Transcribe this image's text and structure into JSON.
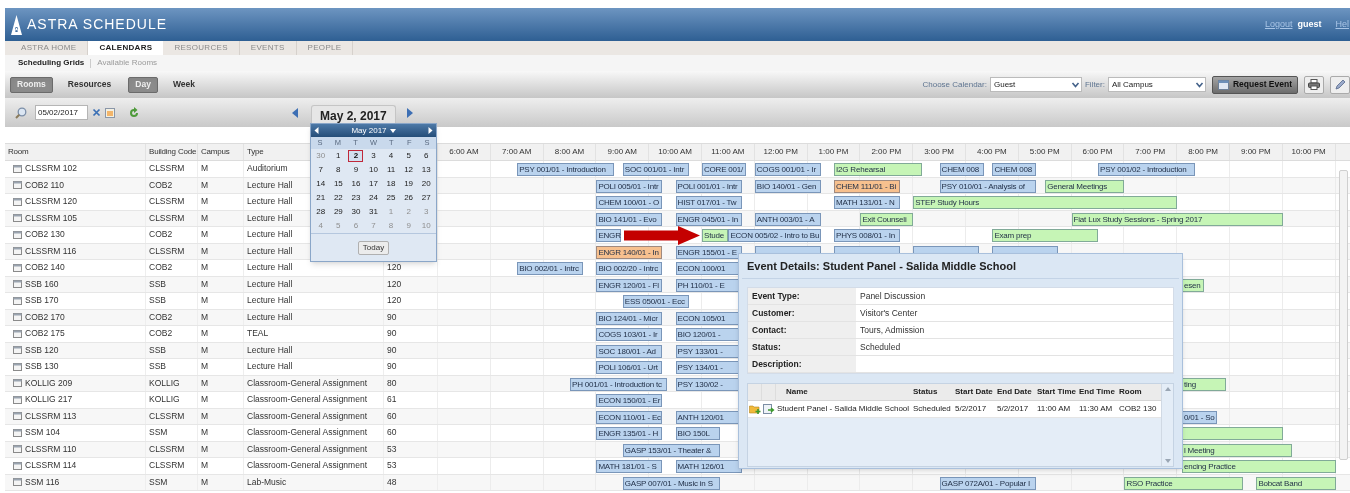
{
  "header": {
    "app_title": "ASTRA SCHEDULE",
    "logout": "Logout",
    "user": "guest",
    "help": "Hel"
  },
  "tabs": [
    {
      "label": "ASTRA HOME",
      "selected": false
    },
    {
      "label": "CALENDARS",
      "selected": true
    },
    {
      "label": "RESOURCES",
      "selected": false
    },
    {
      "label": "EVENTS",
      "selected": false
    },
    {
      "label": "PEOPLE",
      "selected": false
    }
  ],
  "subtabs": [
    {
      "label": "Scheduling Grids",
      "selected": true
    },
    {
      "label": "Available Rooms",
      "selected": false
    }
  ],
  "view_toggles": [
    {
      "label": "Rooms",
      "selected": true
    },
    {
      "label": "Resources",
      "selected": false
    }
  ],
  "range_toggles": [
    {
      "label": "Day",
      "selected": true
    },
    {
      "label": "Week",
      "selected": false
    }
  ],
  "calendar_select": {
    "label": "Choose Calendar:",
    "value": "Guest"
  },
  "filter_select": {
    "label": "Filter:",
    "value": "All Campus"
  },
  "request_button": "Request Event",
  "date_field": {
    "value": "05/02/2017"
  },
  "date_heading": "May 2, 2017",
  "date_picker": {
    "month": "May 2017",
    "weekdays": [
      "S",
      "M",
      "T",
      "W",
      "T",
      "F",
      "S"
    ],
    "today_button": "Today",
    "days": [
      {
        "day": "30",
        "muted": true,
        "selected": false
      },
      {
        "day": "1",
        "muted": false,
        "selected": false
      },
      {
        "day": "2",
        "muted": false,
        "selected": true
      },
      {
        "day": "3",
        "muted": false,
        "selected": false
      },
      {
        "day": "4",
        "muted": false,
        "selected": false
      },
      {
        "day": "5",
        "muted": false,
        "selected": false
      },
      {
        "day": "6",
        "muted": false,
        "selected": false
      },
      {
        "day": "7",
        "muted": false,
        "selected": false
      },
      {
        "day": "8",
        "muted": false,
        "selected": false
      },
      {
        "day": "9",
        "muted": false,
        "selected": false
      },
      {
        "day": "10",
        "muted": false,
        "selected": false
      },
      {
        "day": "11",
        "muted": false,
        "selected": false
      },
      {
        "day": "12",
        "muted": false,
        "selected": false
      },
      {
        "day": "13",
        "muted": false,
        "selected": false
      },
      {
        "day": "14",
        "muted": false,
        "selected": false
      },
      {
        "day": "15",
        "muted": false,
        "selected": false
      },
      {
        "day": "16",
        "muted": false,
        "selected": false
      },
      {
        "day": "17",
        "muted": false,
        "selected": false
      },
      {
        "day": "18",
        "muted": false,
        "selected": false
      },
      {
        "day": "19",
        "muted": false,
        "selected": false
      },
      {
        "day": "20",
        "muted": false,
        "selected": false
      },
      {
        "day": "21",
        "muted": false,
        "selected": false
      },
      {
        "day": "22",
        "muted": false,
        "selected": false
      },
      {
        "day": "23",
        "muted": false,
        "selected": false
      },
      {
        "day": "24",
        "muted": false,
        "selected": false
      },
      {
        "day": "25",
        "muted": false,
        "selected": false
      },
      {
        "day": "26",
        "muted": false,
        "selected": false
      },
      {
        "day": "27",
        "muted": false,
        "selected": false
      },
      {
        "day": "28",
        "muted": false,
        "selected": false
      },
      {
        "day": "29",
        "muted": false,
        "selected": false
      },
      {
        "day": "30",
        "muted": false,
        "selected": false
      },
      {
        "day": "31",
        "muted": false,
        "selected": false
      },
      {
        "day": "1",
        "muted": true,
        "selected": false
      },
      {
        "day": "2",
        "muted": true,
        "selected": false
      },
      {
        "day": "3",
        "muted": true,
        "selected": false
      },
      {
        "day": "4",
        "muted": true,
        "selected": false
      },
      {
        "day": "5",
        "muted": true,
        "selected": false
      },
      {
        "day": "6",
        "muted": true,
        "selected": false
      },
      {
        "day": "7",
        "muted": true,
        "selected": false
      },
      {
        "day": "8",
        "muted": true,
        "selected": false
      },
      {
        "day": "9",
        "muted": true,
        "selected": false
      },
      {
        "day": "10",
        "muted": true,
        "selected": false
      }
    ]
  },
  "grid": {
    "columns": [
      "Room",
      "Building Code",
      "Campus",
      "Type"
    ],
    "hours": [
      "6:00 AM",
      "7:00 AM",
      "8:00 AM",
      "9:00 AM",
      "10:00 AM",
      "11:00 AM",
      "12:00 PM",
      "1:00 PM",
      "2:00 PM",
      "3:00 PM",
      "4:00 PM",
      "5:00 PM",
      "6:00 PM",
      "7:00 PM",
      "8:00 PM",
      "9:00 PM",
      "10:00 PM"
    ],
    "rows": [
      {
        "room": "CLSSRM 102",
        "building_code": "CLSSRM",
        "campus": "M",
        "type": "Auditorium",
        "events": [
          {
            "title": "PSY 001/01 - Introduction",
            "color": "#bad3ee"
          },
          {
            "title": "SOC 001/01 - Intr",
            "color": "#bad3ee"
          },
          {
            "title": "CORE 001/",
            "color": "#bad3ee"
          },
          {
            "title": "COGS 001/01 - Ir",
            "color": "#bad3ee"
          },
          {
            "title": "I2G Rehearsal",
            "color": "#c6f5b6"
          },
          {
            "title": "CHEM 008",
            "color": "#bad3ee"
          },
          {
            "title": "CHEM 008",
            "color": "#bad3ee"
          },
          {
            "title": "PSY 001/02 - Introduction",
            "color": "#bad3ee"
          }
        ]
      },
      {
        "room": "COB2 110",
        "building_code": "COB2",
        "campus": "M",
        "type": "Lecture Hall",
        "events": [
          {
            "title": "POLI 005/01 - Intr",
            "color": "#bad3ee"
          },
          {
            "title": "POLI 001/01 - Intr",
            "color": "#bad3ee"
          },
          {
            "title": "BIO 140/01 - Gen",
            "color": "#bad3ee"
          },
          {
            "title": "CHEM 111/01 - Bi",
            "color": "#f7c08e"
          },
          {
            "title": "PSY 010/01 - Analysis of",
            "color": "#bad3ee"
          },
          {
            "title": "General Meetings",
            "color": "#c6f5b6"
          }
        ]
      },
      {
        "room": "CLSSRM 120",
        "building_code": "CLSSRM",
        "campus": "M",
        "type": "Lecture Hall",
        "events": [
          {
            "title": "CHEM 100/01 - O",
            "color": "#bad3ee"
          },
          {
            "title": "HIST 017/01 - Tw",
            "color": "#bad3ee"
          },
          {
            "title": "MATH 131/01 - N",
            "color": "#bad3ee"
          },
          {
            "title": "STEP Study Hours",
            "color": "#c6f5b6"
          }
        ]
      },
      {
        "room": "CLSSRM 105",
        "building_code": "CLSSRM",
        "campus": "M",
        "type": "Lecture Hall",
        "events": [
          {
            "title": "BIO 141/01 - Evo",
            "color": "#bad3ee"
          },
          {
            "title": "ENGR 045/01 - In",
            "color": "#bad3ee"
          },
          {
            "title": "ANTH 003/01 - A",
            "color": "#bad3ee"
          },
          {
            "title": "Exit Counseli",
            "color": "#c6f5b6"
          },
          {
            "title": "Fiat Lux Study Sessions - Spring 2017",
            "color": "#c6f5b6"
          }
        ]
      },
      {
        "room": "COB2 130",
        "building_code": "COB2",
        "campus": "M",
        "type": "Lecture Hall",
        "events": [
          {
            "title": "ENGR",
            "color": "#bad3ee"
          },
          {
            "title": "Stude",
            "color": "#c6f5b6"
          },
          {
            "title": "ECON 005/02 - Intro to Bu",
            "color": "#bad3ee"
          },
          {
            "title": "PHYS 008/01 - In",
            "color": "#bad3ee"
          },
          {
            "title": "Exam prep",
            "color": "#c6f5b6"
          }
        ]
      },
      {
        "room": "CLSSRM 116",
        "building_code": "CLSSRM",
        "campus": "M",
        "type": "Lecture Hall",
        "events": [
          {
            "title": "ENGR 140/01 - In",
            "color": "#f7c08e"
          },
          {
            "title": "ENGR 155/01 - E",
            "color": "#bad3ee"
          },
          {
            "color": "#bad3ee"
          },
          {
            "color": "#bad3ee"
          },
          {
            "color": "#bad3ee"
          },
          {
            "color": "#bad3ee"
          }
        ]
      },
      {
        "room": "COB2 140",
        "building_code": "COB2",
        "campus": "M",
        "type": "Lecture Hall",
        "capacity": "120",
        "events": [
          {
            "title": "BIO 002/01 - Intrc",
            "color": "#bad3ee"
          },
          {
            "title": "BIO 002/20 - Intrc",
            "color": "#bad3ee"
          },
          {
            "title": "ECON 100/01",
            "color": "#bad3ee"
          }
        ]
      },
      {
        "room": "SSB 160",
        "building_code": "SSB",
        "campus": "M",
        "type": "Lecture Hall",
        "capacity": "120",
        "events": [
          {
            "title": "ENGR 120/01 - Fl",
            "color": "#bad3ee"
          },
          {
            "title": "PH 110/01 - E",
            "color": "#bad3ee"
          },
          {
            "title": "esen",
            "color": "#c6f5b6"
          }
        ]
      },
      {
        "room": "SSB 170",
        "building_code": "SSB",
        "campus": "M",
        "type": "Lecture Hall",
        "capacity": "120",
        "events": [
          {
            "title": "ESS 050/01 - Ecc",
            "color": "#bad3ee"
          }
        ]
      },
      {
        "room": "COB2 170",
        "building_code": "COB2",
        "campus": "M",
        "type": "Lecture Hall",
        "capacity": "90",
        "events": [
          {
            "title": "BIO 124/01 - Micr",
            "color": "#bad3ee"
          },
          {
            "title": "ECON 105/01",
            "color": "#bad3ee"
          }
        ]
      },
      {
        "room": "COB2 175",
        "building_code": "COB2",
        "campus": "M",
        "type": "TEAL",
        "capacity": "90",
        "events": [
          {
            "title": "COGS 103/01 - Ir",
            "color": "#bad3ee"
          },
          {
            "title": "BIO 120/01 -",
            "color": "#bad3ee"
          }
        ]
      },
      {
        "room": "SSB 120",
        "building_code": "SSB",
        "campus": "M",
        "type": "Lecture Hall",
        "capacity": "90",
        "events": [
          {
            "title": "SOC 180/01 - Ad",
            "color": "#bad3ee"
          },
          {
            "title": "PSY 133/01 -",
            "color": "#bad3ee"
          }
        ]
      },
      {
        "room": "SSB 130",
        "building_code": "SSB",
        "campus": "M",
        "type": "Lecture Hall",
        "capacity": "90",
        "events": [
          {
            "title": "POLI 106/01 - Urt",
            "color": "#bad3ee"
          },
          {
            "title": "PSY 134/01 -",
            "color": "#bad3ee"
          }
        ]
      },
      {
        "room": "KOLLIG 209",
        "building_code": "KOLLIG",
        "campus": "M",
        "type": "Classroom-General Assignment",
        "capacity": "80",
        "events": [
          {
            "title": "PH 001/01 - Introduction tc",
            "color": "#bad3ee"
          },
          {
            "title": "PSY 130/02 -",
            "color": "#bad3ee"
          },
          {
            "title": "ting",
            "color": "#c6f5b6"
          }
        ]
      },
      {
        "room": "KOLLIG 217",
        "building_code": "KOLLIG",
        "campus": "M",
        "type": "Classroom-General Assignment",
        "capacity": "61",
        "events": [
          {
            "title": "ECON 150/01 - Er",
            "color": "#bad3ee"
          }
        ]
      },
      {
        "room": "CLSSRM 113",
        "building_code": "CLSSRM",
        "campus": "M",
        "type": "Classroom-General Assignment",
        "capacity": "60",
        "events": [
          {
            "title": "ECON 110/01 - Ec",
            "color": "#bad3ee"
          },
          {
            "title": "ANTH 120/01",
            "color": "#bad3ee"
          },
          {
            "title": "0/01 - So",
            "color": "#bad3ee"
          }
        ]
      },
      {
        "room": "SSM 104",
        "building_code": "SSM",
        "campus": "M",
        "type": "Classroom-General Assignment",
        "capacity": "60",
        "events": [
          {
            "title": "ENGR 135/01 - H",
            "color": "#bad3ee"
          },
          {
            "title": "BIO 150L",
            "color": "#bad3ee"
          },
          {
            "color": "#c6f5b6"
          }
        ]
      },
      {
        "room": "CLSSRM 110",
        "building_code": "CLSSRM",
        "campus": "M",
        "type": "Classroom-General Assignment",
        "capacity": "53",
        "events": [
          {
            "title": "GASP 153/01 - Theater &",
            "color": "#bad3ee"
          },
          {
            "title": "l Meeting",
            "color": "#c6f5b6"
          }
        ]
      },
      {
        "room": "CLSSRM 114",
        "building_code": "CLSSRM",
        "campus": "M",
        "type": "Classroom-General Assignment",
        "capacity": "53",
        "events": [
          {
            "title": "MATH 181/01 - S",
            "color": "#bad3ee"
          },
          {
            "title": "MATH 126/01",
            "color": "#bad3ee"
          },
          {
            "title": "encing Practice",
            "color": "#c6f5b6"
          }
        ]
      },
      {
        "room": "SSM 116",
        "building_code": "SSM",
        "campus": "M",
        "type": "Lab-Music",
        "capacity": "48",
        "events": [
          {
            "title": "GASP 007/01 - Music in S",
            "color": "#bad3ee"
          },
          {
            "title": "GASP 072A/01 - Popular I",
            "color": "#bad3ee"
          },
          {
            "title": "RSO Practice",
            "color": "#c6f5b6"
          },
          {
            "title": "Bobcat Band",
            "color": "#c6f5b6"
          }
        ]
      }
    ]
  },
  "event_details": {
    "title": "Event Details: Student Panel - Salida Middle School",
    "fields": [
      {
        "label": "Event Type:",
        "value": "Panel Discussion"
      },
      {
        "label": "Customer:",
        "value": "Visitor's Center"
      },
      {
        "label": "Contact:",
        "value": "Tours, Admission"
      },
      {
        "label": "Status:",
        "value": "Scheduled"
      },
      {
        "label": "Description:"
      }
    ],
    "list": {
      "columns": [
        "Name",
        "Status",
        "Start Date",
        "End Date",
        "Start Time",
        "End Time",
        "Room"
      ],
      "rows": [
        {
          "cells": [
            "Student Panel - Salida Middle School",
            "Scheduled",
            "5/2/2017",
            "5/2/2017",
            "11:00 AM",
            "11:30 AM",
            "COB2 130"
          ]
        }
      ]
    }
  }
}
